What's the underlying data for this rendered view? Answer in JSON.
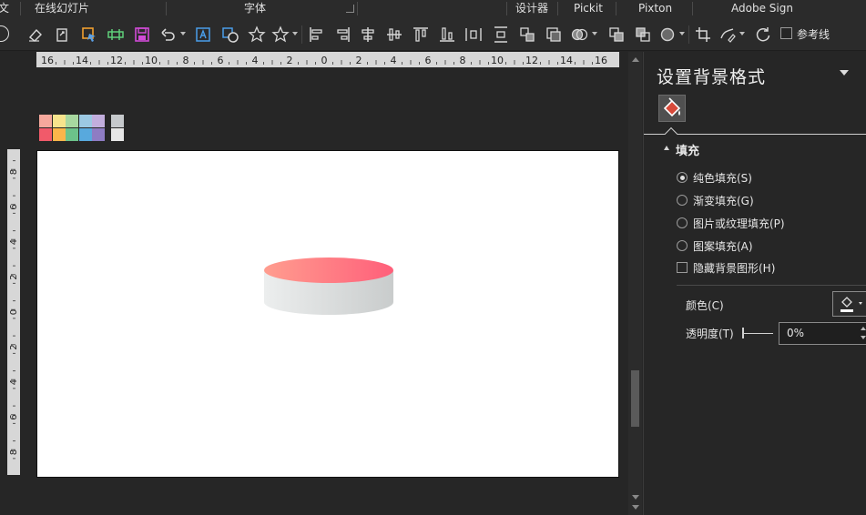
{
  "ribbon": {
    "groups": [
      {
        "label": "文"
      },
      {
        "label": "在线幻灯片"
      },
      {
        "label": "字体"
      },
      {
        "label": "设计器"
      },
      {
        "label": "Pickit"
      },
      {
        "label": "Pixton"
      },
      {
        "label": "Adobe Sign"
      }
    ],
    "guides_label": "参考线"
  },
  "rulers": {
    "horizontal": [
      "16",
      "14",
      "12",
      "10",
      "8",
      "6",
      "4",
      "2",
      "0",
      "2",
      "4",
      "6",
      "8",
      "10",
      "12",
      "14",
      "16"
    ],
    "vertical": [
      "8",
      "6",
      "4",
      "2",
      "0",
      "2",
      "4",
      "6",
      "8"
    ]
  },
  "palette": {
    "top_row": [
      "#f6a89c",
      "#f7e38c",
      "#a8d8a0",
      "#9cc9e3",
      "#c2aedd",
      "#c6c9cc"
    ],
    "bottom_row": [
      "#f15a6a",
      "#fbb54a",
      "#6cc28a",
      "#58a9dd",
      "#8e7cc3",
      "#e6e6e6"
    ]
  },
  "slide": {
    "shape": "cylinder",
    "top_gradient": [
      "#ff9d8f",
      "#ff5f7a"
    ],
    "side_color": "#d6d8d8"
  },
  "panel": {
    "title": "设置背景格式",
    "section": "填充",
    "options": [
      {
        "label": "纯色填充(S)",
        "selected": true
      },
      {
        "label": "渐变填充(G)",
        "selected": false
      },
      {
        "label": "图片或纹理填充(P)",
        "selected": false
      },
      {
        "label": "图案填充(A)",
        "selected": false
      }
    ],
    "hide_background_label": "隐藏背景图形(H)",
    "color_label": "颜色(C)",
    "transparency_label": "透明度(T)",
    "transparency_value": "0%"
  }
}
